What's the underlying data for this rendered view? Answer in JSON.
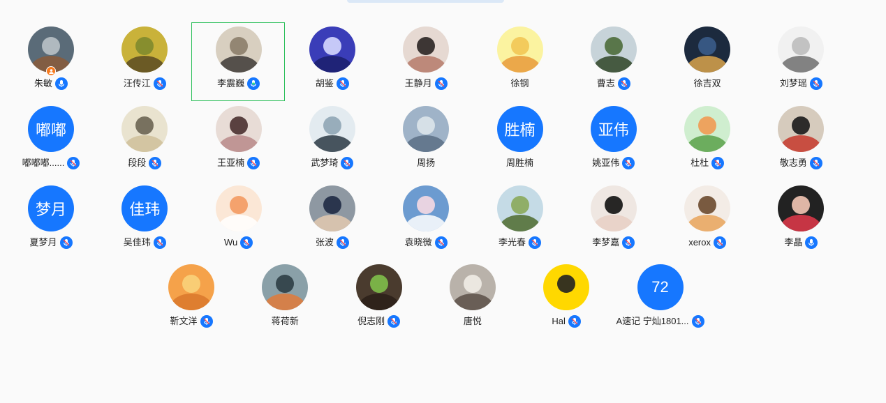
{
  "colors": {
    "accent": "#1677ff",
    "selected_border": "#2cbf5a",
    "host_badge": "#f7791c",
    "background": "#fafafa"
  },
  "participants": [
    {
      "name": "朱敏",
      "avatar": "photo",
      "host": true,
      "mic": "on"
    },
    {
      "name": "汪传江",
      "avatar": "photo",
      "mic": "muted"
    },
    {
      "name": "李震巍",
      "avatar": "photo",
      "mic": "speaking",
      "selected": true
    },
    {
      "name": "胡鉴",
      "avatar": "photo",
      "mic": "muted"
    },
    {
      "name": "王静月",
      "avatar": "photo",
      "mic": "muted"
    },
    {
      "name": "徐钢",
      "avatar": "photo"
    },
    {
      "name": "曹志",
      "avatar": "photo",
      "mic": "muted"
    },
    {
      "name": "徐吉双",
      "avatar": "photo"
    },
    {
      "name": "刘梦瑶",
      "avatar": "photo",
      "mic": "muted"
    },
    {
      "name": "嘟嘟嘟......",
      "avatar_text": "嘟嘟",
      "mic": "muted"
    },
    {
      "name": "段段",
      "avatar": "photo",
      "mic": "muted"
    },
    {
      "name": "王亚楠",
      "avatar": "photo",
      "mic": "muted"
    },
    {
      "name": "武梦琦",
      "avatar": "photo",
      "mic": "muted"
    },
    {
      "name": "周扬",
      "avatar": "photo"
    },
    {
      "name": "周胜楠",
      "avatar_text": "胜楠"
    },
    {
      "name": "姚亚伟",
      "avatar_text": "亚伟",
      "mic": "muted"
    },
    {
      "name": "杜杜",
      "avatar": "photo",
      "mic": "muted"
    },
    {
      "name": "敬志勇",
      "avatar": "photo",
      "mic": "muted"
    },
    {
      "name": "夏梦月",
      "avatar_text": "梦月",
      "mic": "muted"
    },
    {
      "name": "吴佳玮",
      "avatar_text": "佳玮",
      "mic": "muted"
    },
    {
      "name": "Wu",
      "avatar": "photo",
      "mic": "muted"
    },
    {
      "name": "张波",
      "avatar": "photo",
      "mic": "muted"
    },
    {
      "name": "袁晓微",
      "avatar": "photo",
      "mic": "muted"
    },
    {
      "name": "李光春",
      "avatar": "photo",
      "mic": "muted"
    },
    {
      "name": "李梦嘉",
      "avatar": "photo",
      "mic": "muted"
    },
    {
      "name": "xerox",
      "avatar": "photo",
      "mic": "muted"
    },
    {
      "name": "李晶",
      "avatar": "photo",
      "mic": "on"
    },
    {
      "name": "靳文洋",
      "avatar": "photo",
      "mic": "muted"
    },
    {
      "name": "蒋荷新",
      "avatar": "photo"
    },
    {
      "name": "倪志刚",
      "avatar": "photo",
      "mic": "muted"
    },
    {
      "name": "唐悦",
      "avatar": "photo"
    },
    {
      "name": "Hal",
      "avatar": "photo",
      "mic": "muted"
    },
    {
      "name": "A速记 宁灿1801...",
      "avatar_text": "72",
      "mic": "muted"
    }
  ]
}
